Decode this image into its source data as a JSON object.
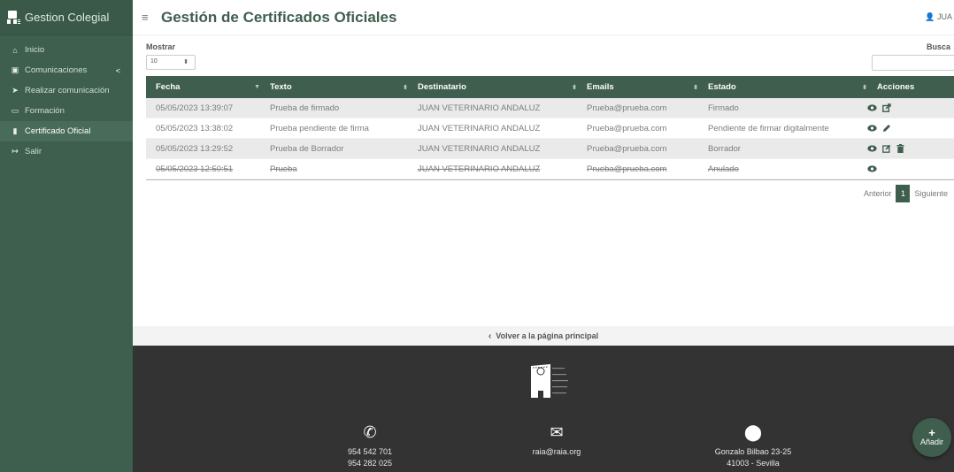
{
  "brand": {
    "title": "Gestion Colegial"
  },
  "sidebar": {
    "items": [
      {
        "label": "Inicio",
        "icon": "home-icon"
      },
      {
        "label": "Comunicaciones",
        "icon": "comments-icon",
        "chevron": "<"
      },
      {
        "label": "Realizar comunicación",
        "icon": "paper-plane-icon"
      },
      {
        "label": "Formación",
        "icon": "chalkboard-icon"
      },
      {
        "label": "Certificado Oficial",
        "icon": "file-icon"
      },
      {
        "label": "Salir",
        "icon": "sign-out-icon"
      }
    ]
  },
  "header": {
    "title": "Gestión de Certificados Oficiales",
    "user": "JUA"
  },
  "controls": {
    "show_label": "Mostrar",
    "show_value": "10",
    "search_label": "Busca",
    "search_value": ""
  },
  "table": {
    "columns": [
      "Fecha",
      "Texto",
      "Destinatario",
      "Emails",
      "Estado",
      "Acciones"
    ],
    "rows": [
      {
        "fecha": "05/05/2023 13:39:07",
        "texto": "Prueba de firmado",
        "destinatario": "JUAN VETERINARIO ANDALUZ",
        "email": "Prueba@prueba.com",
        "estado": "Firmado"
      },
      {
        "fecha": "05/05/2023 13:38:02",
        "texto": "Prueba pendiente de firma",
        "destinatario": "JUAN VETERINARIO ANDALUZ",
        "email": "Prueba@prueba.com",
        "estado": "Pendiente de firmar digitalmente"
      },
      {
        "fecha": "05/05/2023 13:29:52",
        "texto": "Prueba de Borrador",
        "destinatario": "JUAN VETERINARIO ANDALUZ",
        "email": "Prueba@prueba.com",
        "estado": "Borrador"
      },
      {
        "fecha": "05/05/2023 12:50:51",
        "texto": "Prueba",
        "destinatario": "JUAN VETERINARIO ANDALUZ",
        "email": "Prueba@prueba.com",
        "estado": "Anulado"
      }
    ]
  },
  "pagination": {
    "prev": "Anterior",
    "current": "1",
    "next": "Siguiente"
  },
  "back_link": {
    "label": "Volver a la página principal"
  },
  "footer": {
    "phone1": "954 542 701",
    "phone2": "954 282 025",
    "email": "raia@raia.org",
    "address1": "Gonzalo Bilbao 23-25",
    "address2": "41003 - Sevilla"
  },
  "fab": {
    "label": "Añadir"
  },
  "colors": {
    "primary": "#3f5e4e",
    "sidebar": "#3e5e4e",
    "footer": "#333333"
  }
}
